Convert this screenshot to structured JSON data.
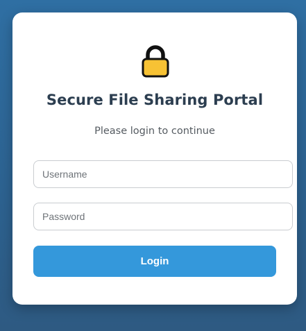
{
  "login_card": {
    "lock_icon": "padlock-icon",
    "title": "Secure File Sharing Portal",
    "subtitle": "Please login to continue",
    "username": {
      "placeholder": "Username",
      "value": ""
    },
    "password": {
      "placeholder": "Password",
      "value": ""
    },
    "login_label": "Login"
  },
  "colors": {
    "background": "#2f6fa3",
    "card": "#ffffff",
    "title": "#2c3e50",
    "button": "#3498db",
    "lock_body": "#f7c234"
  }
}
